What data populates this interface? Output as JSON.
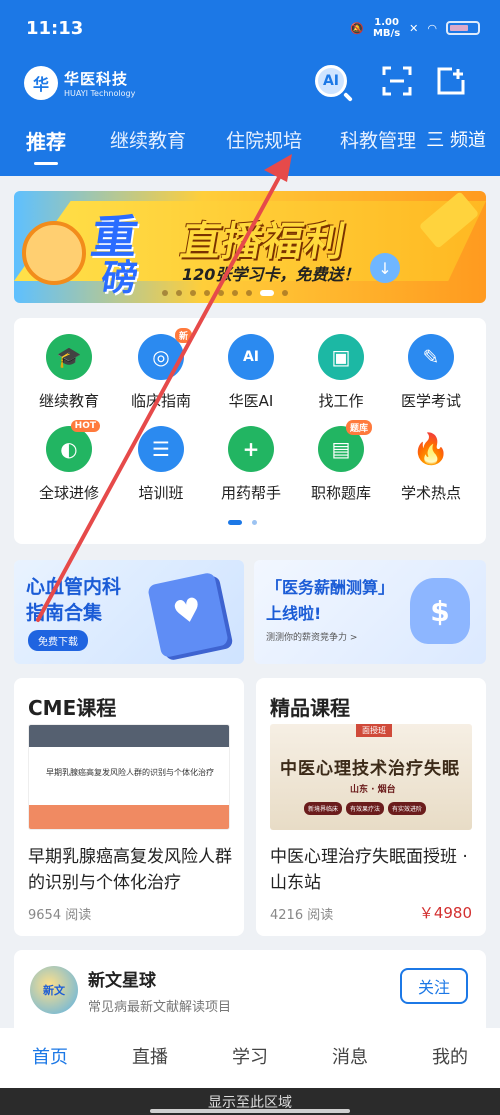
{
  "status_bar": {
    "time": "11:13",
    "speed_value": "1.00",
    "speed_unit": "MB/s"
  },
  "header": {
    "logo_cn": "华医科技",
    "logo_en": "HUAYI Technology",
    "logo_mark": "华",
    "ai_label": "AI",
    "icons": [
      "ai-search-icon",
      "scan-icon",
      "add-note-icon"
    ]
  },
  "tabs": [
    {
      "label": "推荐",
      "active": true
    },
    {
      "label": "继续教育"
    },
    {
      "label": "住院规培"
    },
    {
      "label": "科教管理"
    }
  ],
  "channel_label": "三 频道",
  "banner": {
    "word1": "重",
    "word2": "磅",
    "title": "直播福利",
    "subtitle": "120张学习卡，免费送！",
    "dot_count": 9
  },
  "grid_items": [
    {
      "label": "继续教育",
      "icon": "graduation-cap-icon",
      "color": "#22b562",
      "badge": ""
    },
    {
      "label": "临床指南",
      "icon": "guide-book-icon",
      "color": "#2b8af0",
      "badge": "新"
    },
    {
      "label": "华医AI",
      "icon": "ai-icon",
      "color": "#2b8af0",
      "badge": ""
    },
    {
      "label": "找工作",
      "icon": "briefcase-icon",
      "color": "#1cb8a4",
      "badge": ""
    },
    {
      "label": "医学考试",
      "icon": "exam-edit-icon",
      "color": "#2b8af0",
      "badge": ""
    },
    {
      "label": "全球进修",
      "icon": "globe-icon",
      "color": "#22b562",
      "badge": "HOT"
    },
    {
      "label": "培训班",
      "icon": "training-icon",
      "color": "#2b8af0",
      "badge": ""
    },
    {
      "label": "用药帮手",
      "icon": "medicine-icon",
      "color": "#22b562",
      "badge": ""
    },
    {
      "label": "职称题库",
      "icon": "question-bank-icon",
      "color": "#22b562",
      "badge": "题库"
    },
    {
      "label": "学术热点",
      "icon": "fire-icon",
      "color": "#ff8a2a",
      "badge": ""
    }
  ],
  "promos": [
    {
      "line1": "心血管内科",
      "line2": "指南合集",
      "button": "免费下载"
    },
    {
      "line1": "「医务薪酬测算」",
      "line2": "上线啦!",
      "line3": "测测你的薪资竞争力 >"
    }
  ],
  "courses": [
    {
      "section_title": "CME课程",
      "thumb_text": "早期乳腺癌高复发风险人群的识别与个体化治疗",
      "title": "早期乳腺癌高复发风险人群的识别与个体化治疗",
      "reads": "9654 阅读",
      "price": ""
    },
    {
      "section_title": "精品课程",
      "thumb_tag": "面授班",
      "thumb_title": "中医心理技术治疗失眠",
      "thumb_location": "山东 · 烟台",
      "thumb_pills": [
        "新境界临床",
        "有效果疗法",
        "有实效进阶"
      ],
      "title": "中医心理治疗失眠面授班 · 山东站",
      "reads": "4216 阅读",
      "price": "￥4980"
    }
  ],
  "news": {
    "avatar_text": "新文",
    "name": "新文星球",
    "desc": "常见病最新文献解读项目",
    "follow": "关注"
  },
  "bottom_nav": [
    {
      "label": "首页",
      "active": true
    },
    {
      "label": "直播"
    },
    {
      "label": "学习"
    },
    {
      "label": "消息"
    },
    {
      "label": "我的"
    }
  ],
  "system_hint": "显示至此区域",
  "colors": {
    "brand": "#1c78e6",
    "annotation_arrow": "#e64a4a",
    "price": "#d33030"
  }
}
